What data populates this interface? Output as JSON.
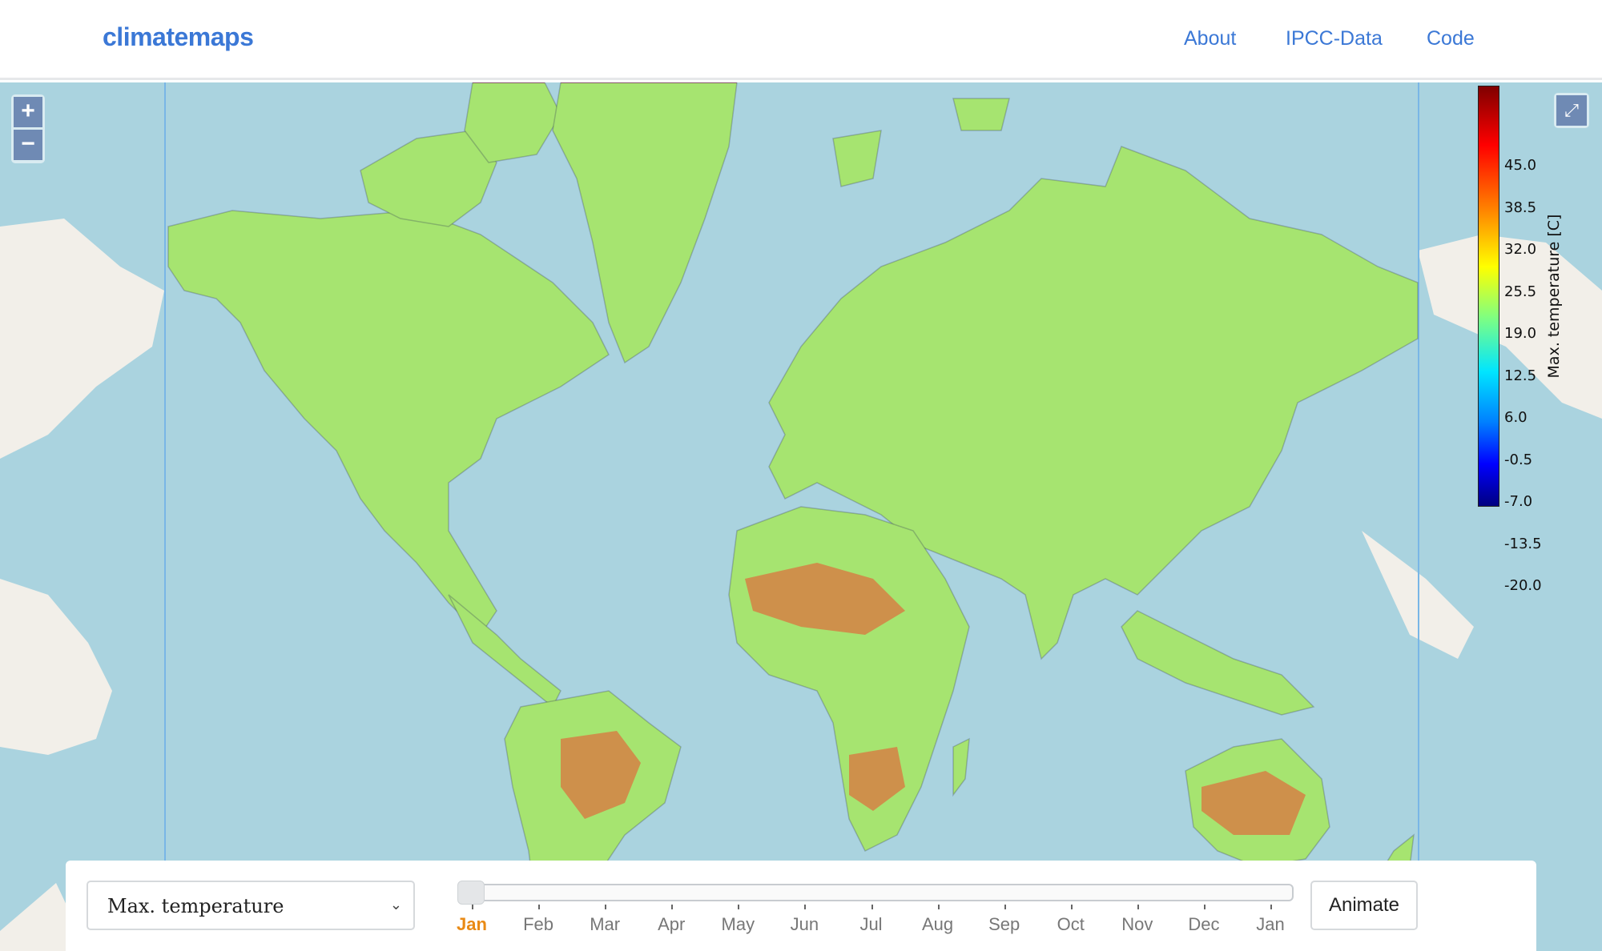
{
  "nav": {
    "brand": "climatemaps",
    "links": [
      "About",
      "IPCC-Data",
      "Code"
    ]
  },
  "map": {
    "zoom_in": "+",
    "zoom_out": "−",
    "fullscreen_icon": "⤢",
    "legend": {
      "title": "Max. temperature [C]",
      "ticks": [
        "45.0",
        "38.5",
        "32.0",
        "25.5",
        "19.0",
        "12.5",
        "6.0",
        "-0.5",
        "-7.0",
        "-13.5",
        "-20.0"
      ],
      "colors": [
        "#7f0000",
        "#ff0000",
        "#ff8000",
        "#ffff00",
        "#80ff80",
        "#00e5ff",
        "#0080ff",
        "#0000ff",
        "#000080"
      ]
    },
    "colors": {
      "ocean": "#aad3df",
      "land": "#f2efe9"
    }
  },
  "controls": {
    "variable": "Max. temperature",
    "months": [
      "Jan",
      "Feb",
      "Mar",
      "Apr",
      "May",
      "Jun",
      "Jul",
      "Aug",
      "Sep",
      "Oct",
      "Nov",
      "Dec",
      "Jan"
    ],
    "selected_month": "Jan",
    "animate_label": "Animate",
    "accent": "#e98a15"
  }
}
